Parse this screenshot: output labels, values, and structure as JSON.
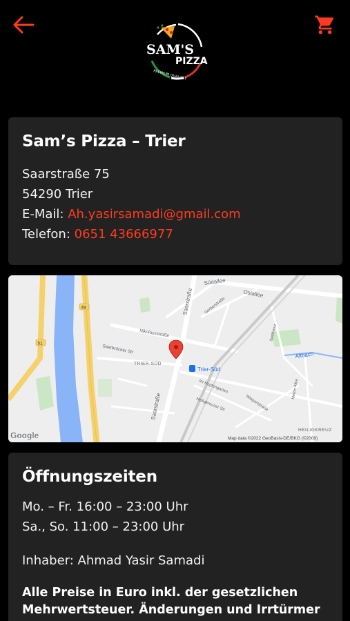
{
  "header": {
    "back_icon": "arrow-left-icon",
    "cart_icon": "shopping-cart-icon",
    "logo_title": "SAM'S",
    "logo_sub": "PIZZA",
    "logo_tagline": "PREMIUM QUALITÄT",
    "accent": "#ff3b1f"
  },
  "info": {
    "title": "Sam’s Pizza – Trier",
    "street": "Saarstraße 75",
    "city": "54290 Trier",
    "email_label": "E-Mail: ",
    "email": "Ah.yasirsamadi@gmail.com",
    "phone_label": "Telefon: ",
    "phone": "0651 43666977"
  },
  "map": {
    "labels": {
      "saarstrasse_top": "Saarstraße",
      "saarstrasse_bottom": "Saarstraße",
      "suedallee": "Südallee",
      "ostallee": "Ostallee",
      "gerberstrasse": "Gerberstraße",
      "nikolausstrasse": "Nikolausstraße",
      "saarbruecker": "Saarbrücker Str",
      "trier_sued": "TRIER-SÜD",
      "station": "Trier-Süd",
      "altbach": "Altbach",
      "hopfengarten": "Im Hopfengarten",
      "heiligkreuzer": "Heiligkreuzer Str",
      "wisportstrasse": "Wisportstraße",
      "heiligkreuz": "HEILIGKREUZ",
      "metzer": "Metzer Allee",
      "spitzkreuz": "Spitzkreuz",
      "road_49": "49",
      "road_51": "51",
      "google": "Google",
      "attribution": "Map data ©2022 GeoBasis-DE/BKG (©2009)"
    }
  },
  "hours": {
    "title": "Öffnungszeiten",
    "weekdays": "Mo. – Fr. 16:00 – 23:00 Uhr",
    "weekend": "Sa., So. 11:00 – 23:00 Uhr",
    "owner": "Inhaber: Ahmad Yasir Samadi",
    "notice": "Alle Preise in Euro inkl. der gesetzlichen Mehrwertsteuer. Änderungen und Irrtürmer"
  }
}
